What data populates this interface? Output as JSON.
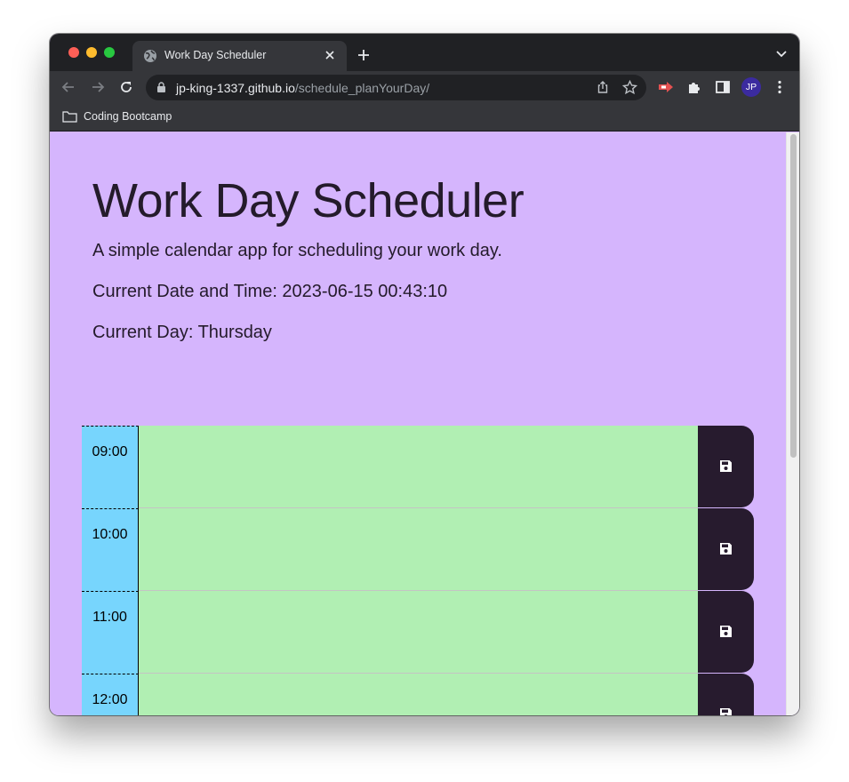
{
  "browser": {
    "tab": {
      "title": "Work Day Scheduler"
    },
    "url": {
      "host": "jp-king-1337.github.io",
      "path": "/schedule_planYourDay/"
    },
    "profile_initials": "JP",
    "bookmarks": [
      {
        "label": "Coding Bootcamp"
      }
    ],
    "colors": {
      "chrome_dark": "#202124",
      "chrome_toolbar": "#35363a",
      "avatar": "#3b2b9f"
    }
  },
  "page": {
    "title": "Work Day Scheduler",
    "lead": "A simple calendar app for scheduling your work day.",
    "datetime": "Current Date and Time: 2023-06-15 00:43:10",
    "day": "Current Day: Thursday",
    "colors": {
      "background": "#d5b5fd",
      "hour_label": "#77d5fd",
      "future_block": "#b1efb3",
      "save_button": "#271b2e"
    },
    "time_blocks": [
      {
        "hour": "09:00",
        "text": ""
      },
      {
        "hour": "10:00",
        "text": ""
      },
      {
        "hour": "11:00",
        "text": ""
      },
      {
        "hour": "12:00",
        "text": ""
      }
    ]
  }
}
